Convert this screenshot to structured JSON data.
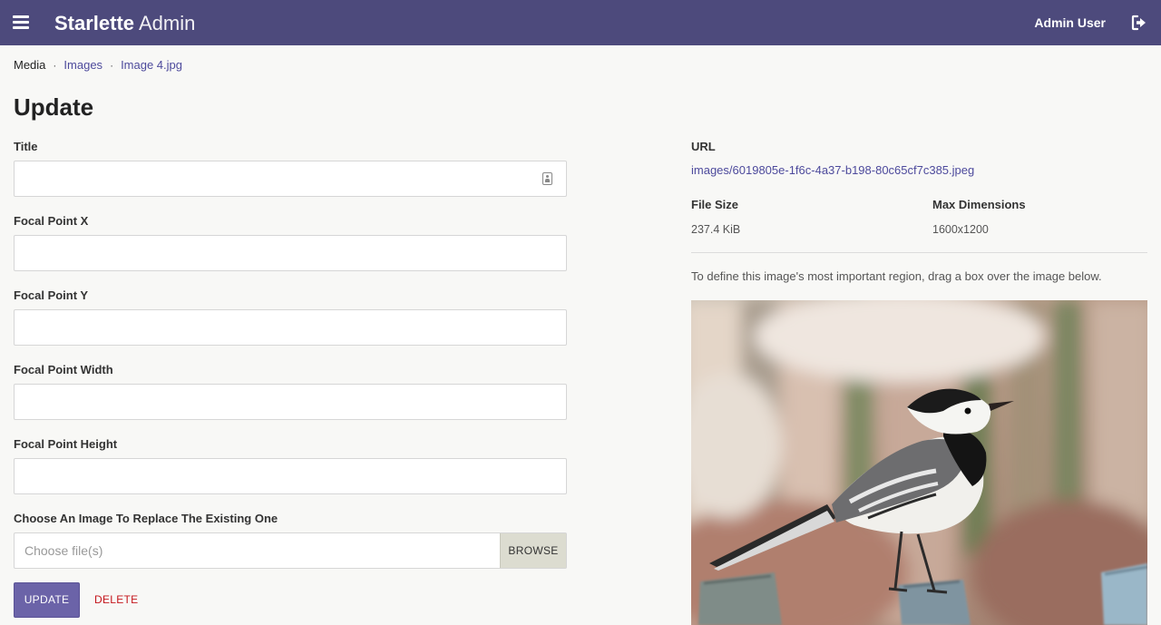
{
  "navbar": {
    "brand_bold": "Starlette",
    "brand_light": "Admin",
    "user": "Admin User"
  },
  "breadcrumb": {
    "items": [
      "Media",
      "Images",
      "Image 4.jpg"
    ],
    "separator": "·"
  },
  "page_title": "Update",
  "form": {
    "title_label": "Title",
    "title_value": "",
    "focal_x_label": "Focal Point X",
    "focal_x_value": "",
    "focal_y_label": "Focal Point Y",
    "focal_y_value": "",
    "focal_width_label": "Focal Point Width",
    "focal_width_value": "",
    "focal_height_label": "Focal Point Height",
    "focal_height_value": "",
    "file_label": "Choose An Image To Replace The Existing One",
    "file_placeholder": "Choose file(s)",
    "browse_label": "BROWSE",
    "update_label": "UPDATE",
    "delete_label": "DELETE"
  },
  "details": {
    "url_label": "URL",
    "url_value": "images/6019805e-1f6c-4a37-b198-80c65cf7c385.jpeg",
    "file_size_label": "File Size",
    "file_size_value": "237.4 KiB",
    "max_dim_label": "Max Dimensions",
    "max_dim_value": "1600x1200",
    "help_text": "To define this image's most important region, drag a box over the image below."
  },
  "colors": {
    "navbar": "#4d4a7c",
    "link": "#4d4a9c",
    "primary_button": "#6b63a8",
    "danger": "#c4161c",
    "background": "#f8f8f6"
  },
  "icons": {
    "menu": "hamburger-icon",
    "logout": "logout-icon",
    "title_field": "contact-card-icon"
  }
}
